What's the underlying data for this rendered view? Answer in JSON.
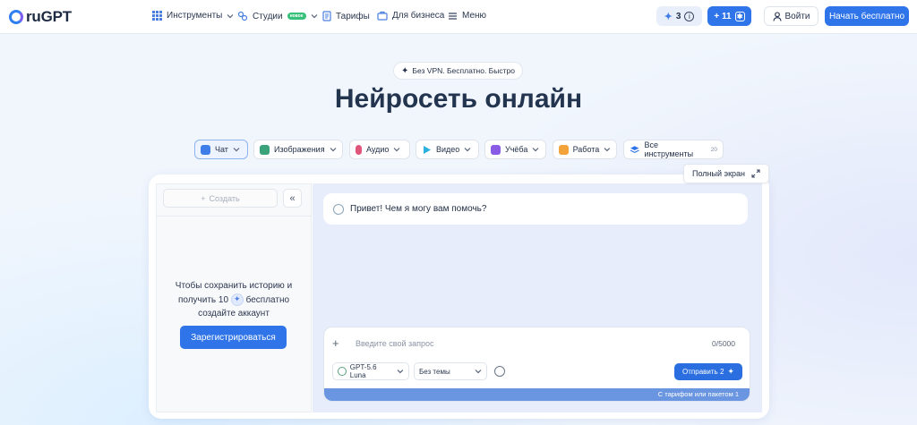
{
  "header": {
    "logo_text": "ruGPT",
    "nav": [
      {
        "label": "Инструменты",
        "icon": "grid-icon",
        "dropdown": true
      },
      {
        "label": "Студии",
        "icon": "studio-icon",
        "badge": "новое",
        "dropdown": true
      },
      {
        "label": "Тарифы",
        "icon": "document-icon",
        "dropdown": false
      },
      {
        "label": "Для бизнеса",
        "icon": "briefcase-icon",
        "dropdown": false
      },
      {
        "label": "Меню",
        "icon": "menu-icon",
        "dropdown": false
      }
    ],
    "credits_count": "3",
    "bonus_label": "+ 11",
    "login_label": "Войти",
    "start_label": "Начать бесплатно"
  },
  "hero": {
    "tagline": "Без VPN. Бесплатно. Быстро",
    "title": "Нейросеть онлайн"
  },
  "categories": [
    {
      "label": "Чат",
      "icon": "chat-icon",
      "color": "#3f7ee8",
      "active": true
    },
    {
      "label": "Изображения",
      "icon": "image-icon",
      "color": "#3aa37a"
    },
    {
      "label": "Аудио",
      "icon": "microphone-icon",
      "color": "#e0567a"
    },
    {
      "label": "Видео",
      "icon": "play-icon",
      "color": "#2bb0e0"
    },
    {
      "label": "Учёба",
      "icon": "book-icon",
      "color": "#8a5ce6"
    },
    {
      "label": "Работа",
      "icon": "briefcase-icon",
      "color": "#f2a33a"
    },
    {
      "label": "Все инструменты",
      "icon": "layers-icon",
      "color": "#2f74e8",
      "count": "20"
    }
  ],
  "chat": {
    "fullscreen_label": "Полный экран",
    "create_label": "Создать",
    "promo_line1": "Чтобы сохранить историю и",
    "promo_line2a": "получить 10",
    "promo_line2b": "бесплатно",
    "promo_line3": "создайте аккаунт",
    "register_label": "Зарегистрироваться",
    "greeting": "Привет! Чем я могу вам помочь?",
    "input_placeholder": "Введите свой запрос",
    "char_counter": "0/5000",
    "model_value": "GPT-5.6 Luna",
    "theme_value": "Без темы",
    "send_label": "Отправить 2",
    "tariff_note": "С тарифом или пакетом 1"
  },
  "colors": {
    "accent": "#2f74e8",
    "brand_dark": "#1c2a42",
    "chat_bg": "#e8edfb"
  }
}
